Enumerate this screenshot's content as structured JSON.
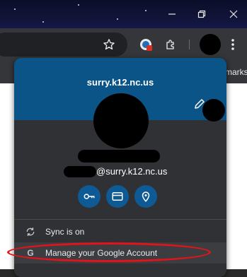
{
  "window": {
    "controls": {
      "minimize": "minimize",
      "restore": "restore",
      "close": "close"
    }
  },
  "toolbar": {
    "icons": [
      "star-icon",
      "extension-badge-icon",
      "puzzle-icon",
      "profile-avatar"
    ]
  },
  "bookmarks_bar": {
    "partial_label": "marks"
  },
  "profile_popup": {
    "organization": "surry.k12.nc.us",
    "email_suffix": "@surry.k12.nc.us",
    "quick_actions": [
      "key-icon",
      "card-icon",
      "location-icon"
    ],
    "menu": {
      "sync_label": "Sync is on",
      "manage_label": "Manage your Google Account"
    }
  },
  "colors": {
    "header": "#0b5487",
    "quick_action_bg": "#0e5a94",
    "annotation": "#e3131b"
  }
}
